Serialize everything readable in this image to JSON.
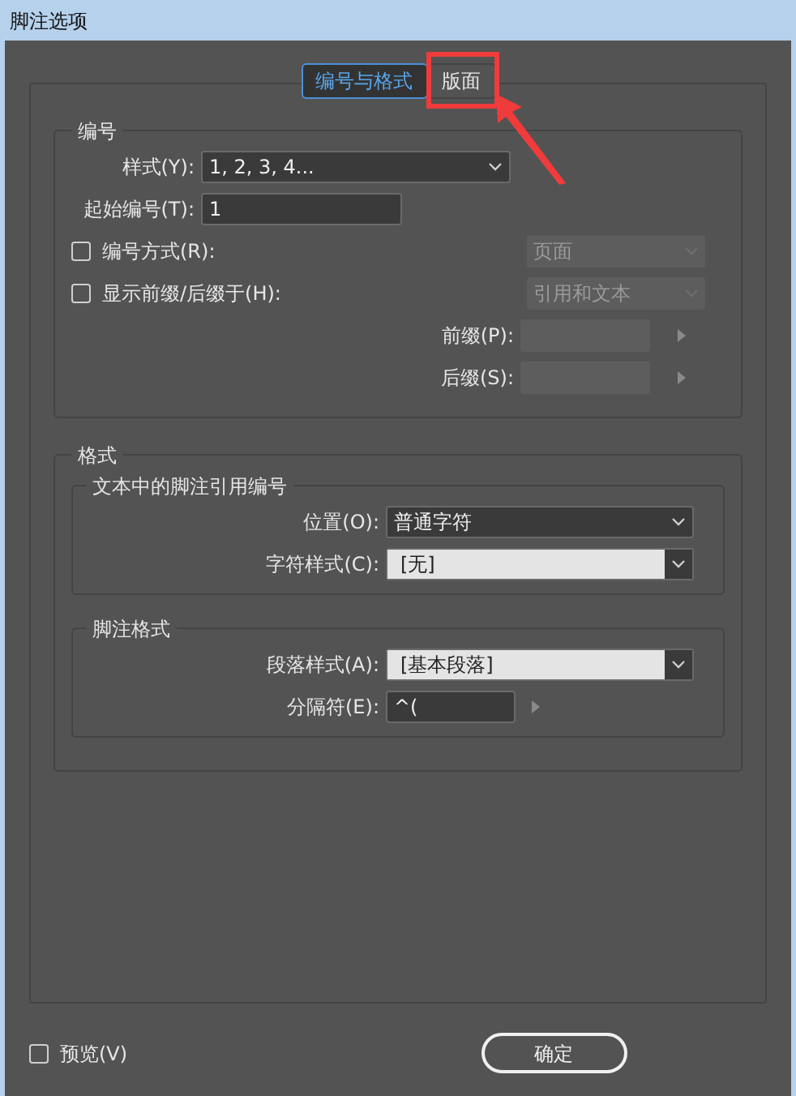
{
  "window": {
    "title": "脚注选项"
  },
  "tabs": [
    {
      "label": "编号与格式",
      "selected": true
    },
    {
      "label": "版面",
      "selected": false
    }
  ],
  "numbering": {
    "title": "编号",
    "style": {
      "label": "样式(Y):",
      "value": "1, 2, 3, 4..."
    },
    "start": {
      "label": "起始编号(T):",
      "value": "1"
    },
    "options": [
      {
        "label": "编号方式(R):",
        "checked": false,
        "value": "页面",
        "disabled": true
      },
      {
        "label": "显示前缀/后缀于(H):",
        "checked": false,
        "value": "引用和文本",
        "disabled": true
      }
    ],
    "affixes": [
      {
        "label": "前缀(P):",
        "disabled": true
      },
      {
        "label": "后缀(S):",
        "disabled": true
      }
    ]
  },
  "format": {
    "title": "格式",
    "groups": [
      {
        "title": "文本中的脚注引用编号",
        "rows": [
          {
            "kind": "dropdown",
            "label": "位置(O):",
            "value": "普通字符"
          },
          {
            "kind": "style",
            "label": "字符样式(C):",
            "value": "[无]"
          }
        ]
      },
      {
        "title": "脚注格式",
        "rows": [
          {
            "kind": "style",
            "label": "段落样式(A):",
            "value": "[基本段落]"
          },
          {
            "kind": "text",
            "label": "分隔符(E):",
            "value": "^("
          }
        ]
      }
    ]
  },
  "preview": {
    "label": "预览(V)",
    "checked": false
  },
  "ok_button": "确定"
}
